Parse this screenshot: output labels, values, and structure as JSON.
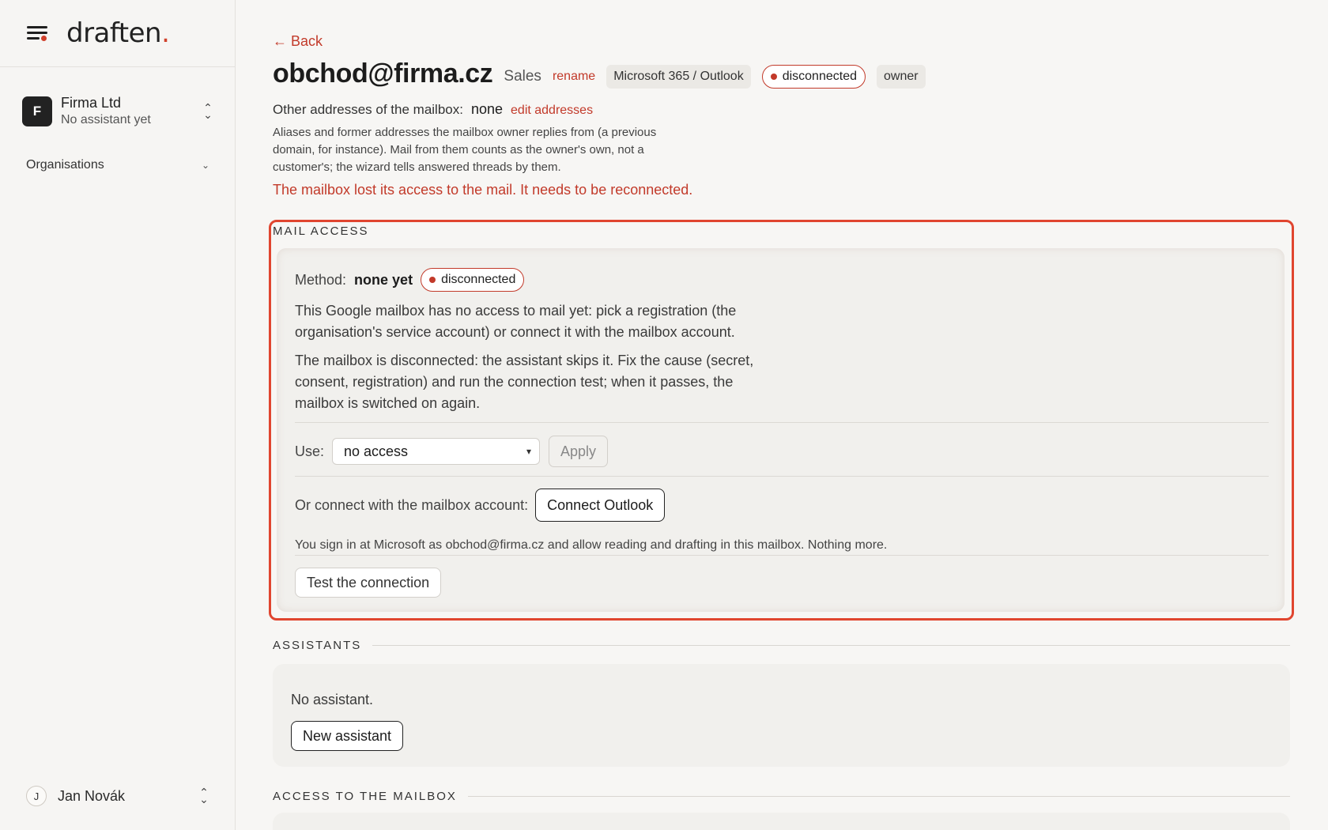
{
  "brand": {
    "name": "draften",
    "dot": "."
  },
  "org": {
    "initial": "F",
    "name": "Firma Ltd",
    "subtitle": "No assistant yet"
  },
  "sidebar": {
    "organisations_label": "Organisations"
  },
  "user": {
    "initial": "J",
    "name": "Jan Novák"
  },
  "header": {
    "back_label": "← Back",
    "title": "obchod@firma.cz",
    "subtitle": "Sales",
    "rename_label": "rename",
    "provider_chip": "Microsoft 365 / Outlook",
    "status": "disconnected",
    "role_chip": "owner"
  },
  "addresses": {
    "label": "Other addresses of the mailbox:",
    "value": "none",
    "edit_label": "edit addresses",
    "help": "Aliases and former addresses the mailbox owner replies from (a previous domain, for instance). Mail from them counts as the owner's own, not a customer's; the wizard tells answered threads by them."
  },
  "alert": "The mailbox lost its access to the mail. It needs to be reconnected.",
  "mail_access": {
    "section_title": "MAIL ACCESS",
    "method_label": "Method:",
    "method_value": "none yet",
    "status": "disconnected",
    "para1": "This Google mailbox has no access to mail yet: pick a registration (the organisation's service account) or connect it with the mailbox account.",
    "para2": "The mailbox is disconnected: the assistant skips it. Fix the cause (secret, consent, registration) and run the connection test; when it passes, the mailbox is switched on again.",
    "use_label": "Use:",
    "use_selected": "no access",
    "apply_label": "Apply",
    "connect_label": "Or connect with the mailbox account:",
    "connect_button": "Connect Outlook",
    "signin_note": "You sign in at Microsoft as obchod@firma.cz and allow reading and drafting in this mailbox. Nothing more.",
    "test_button": "Test the connection"
  },
  "assistants": {
    "section_title": "ASSISTANTS",
    "empty_text": "No assistant.",
    "new_button": "New assistant"
  },
  "access": {
    "section_title": "ACCESS TO THE MAILBOX"
  },
  "colors": {
    "accent": "#c23a2a",
    "highlight": "#e0452f"
  }
}
